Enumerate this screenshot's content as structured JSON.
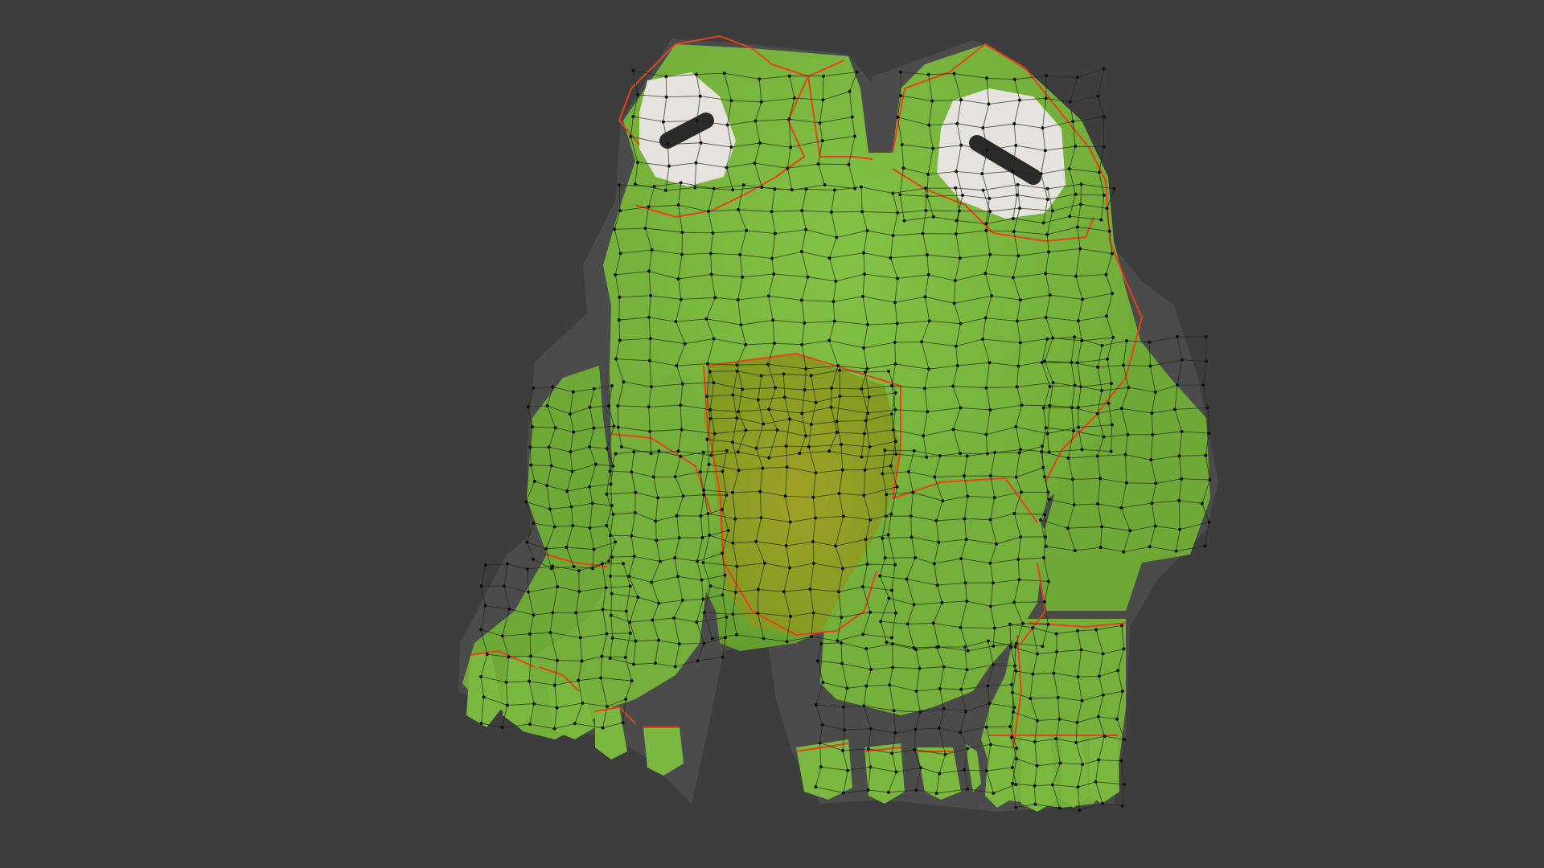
{
  "viewport": {
    "background_color": "#3d3d3d",
    "object": {
      "name_icon": "frog-mesh-icon",
      "colors": {
        "body": "#76b33c",
        "body_shadow": "#5d9a2b",
        "belly": "#8a9c22",
        "eye_white": "#e6e3de",
        "pupil": "#2a2a2a",
        "seam": "#e8411c",
        "wire": "#1c2a12",
        "outline": "#4a4a4a"
      }
    }
  }
}
